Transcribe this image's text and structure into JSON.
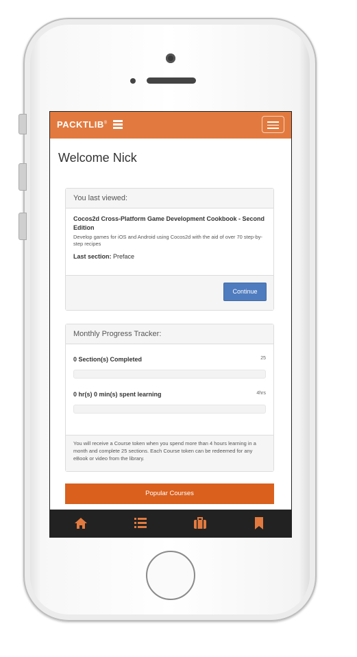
{
  "navbar": {
    "brand": "PACKTLIB",
    "brand_mark": "®"
  },
  "page": {
    "welcome": "Welcome Nick"
  },
  "last_viewed": {
    "heading": "You last viewed:",
    "title": "Cocos2d Cross-Platform Game Development Cookbook - Second Edition",
    "description": "Develop games for iOS and Android using Cocos2d with the aid of over 70 step-by-step recipes",
    "last_section_label": "Last section:",
    "last_section_value": "Preface",
    "continue_label": "Continue"
  },
  "tracker": {
    "heading": "Monthly Progress Tracker:",
    "sections_label": "0 Section(s) Completed",
    "sections_target": "25",
    "sections_progress": 0,
    "time_label": "0 hr(s) 0 min(s) spent learning",
    "time_target": "4hrs",
    "time_progress": 0,
    "footer_text": "You will receive a Course token when you spend more than 4 hours learning in a month and complete 25 sections. Each Course token can be redeemed for any eBook or video from the library."
  },
  "popular_courses_label": "Popular Courses",
  "tabbar": {
    "items": [
      "home-icon",
      "list-icon",
      "briefcase-icon",
      "bookmark-icon"
    ],
    "icon_color": "#e27a3f"
  },
  "colors": {
    "accent": "#e27a3f",
    "button_primary": "#4f7cbf",
    "button_popular": "#d9601d"
  }
}
